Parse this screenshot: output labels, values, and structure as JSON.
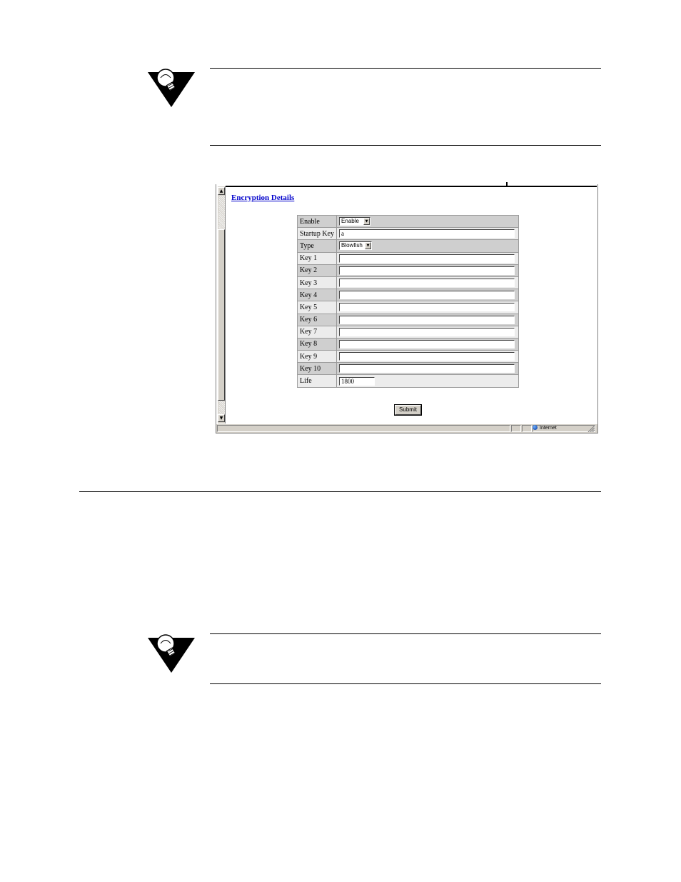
{
  "page_heading": "Encryption Details",
  "form": {
    "rows": [
      {
        "label": "Enable",
        "control": "select",
        "value": "Enable"
      },
      {
        "label": "Startup Key",
        "control": "text",
        "value": "a"
      },
      {
        "label": "Type",
        "control": "select",
        "value": "Blowfish"
      },
      {
        "label": "Key 1",
        "control": "text",
        "value": ""
      },
      {
        "label": "Key 2",
        "control": "text",
        "value": ""
      },
      {
        "label": "Key 3",
        "control": "text",
        "value": ""
      },
      {
        "label": "Key 4",
        "control": "text",
        "value": ""
      },
      {
        "label": "Key 5",
        "control": "text",
        "value": ""
      },
      {
        "label": "Key 6",
        "control": "text",
        "value": ""
      },
      {
        "label": "Key 7",
        "control": "text",
        "value": ""
      },
      {
        "label": "Key 8",
        "control": "text",
        "value": ""
      },
      {
        "label": "Key 9",
        "control": "text",
        "value": ""
      },
      {
        "label": "Key 10",
        "control": "text",
        "value": ""
      },
      {
        "label": "Life",
        "control": "text-short",
        "value": "1800"
      }
    ],
    "submit_label": "Submit"
  },
  "status_bar": {
    "zone": "Internet"
  },
  "icons": {
    "note_icon": "lightbulb-triangle-icon",
    "zone_icon": "globe-icon"
  },
  "colors": {
    "heading_link": "#0000cc",
    "row_dark": "#cfcfcf",
    "row_light": "#ececec",
    "chrome": "#d4d0c8"
  }
}
